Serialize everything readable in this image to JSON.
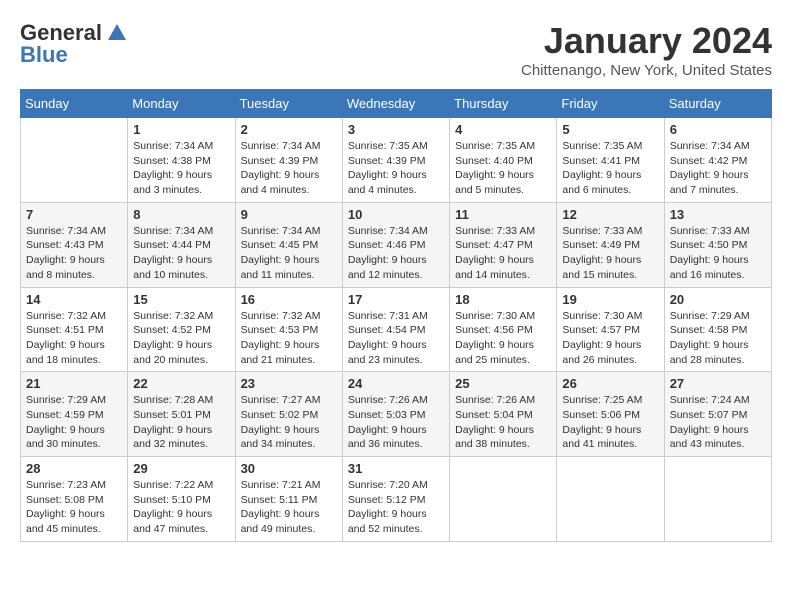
{
  "header": {
    "logo_line1": "General",
    "logo_line2": "Blue",
    "month_title": "January 2024",
    "location": "Chittenango, New York, United States"
  },
  "days_of_week": [
    "Sunday",
    "Monday",
    "Tuesday",
    "Wednesday",
    "Thursday",
    "Friday",
    "Saturday"
  ],
  "weeks": [
    [
      {
        "day": "",
        "sunrise": "",
        "sunset": "",
        "daylight": ""
      },
      {
        "day": "1",
        "sunrise": "Sunrise: 7:34 AM",
        "sunset": "Sunset: 4:38 PM",
        "daylight": "Daylight: 9 hours and 3 minutes."
      },
      {
        "day": "2",
        "sunrise": "Sunrise: 7:34 AM",
        "sunset": "Sunset: 4:39 PM",
        "daylight": "Daylight: 9 hours and 4 minutes."
      },
      {
        "day": "3",
        "sunrise": "Sunrise: 7:35 AM",
        "sunset": "Sunset: 4:39 PM",
        "daylight": "Daylight: 9 hours and 4 minutes."
      },
      {
        "day": "4",
        "sunrise": "Sunrise: 7:35 AM",
        "sunset": "Sunset: 4:40 PM",
        "daylight": "Daylight: 9 hours and 5 minutes."
      },
      {
        "day": "5",
        "sunrise": "Sunrise: 7:35 AM",
        "sunset": "Sunset: 4:41 PM",
        "daylight": "Daylight: 9 hours and 6 minutes."
      },
      {
        "day": "6",
        "sunrise": "Sunrise: 7:34 AM",
        "sunset": "Sunset: 4:42 PM",
        "daylight": "Daylight: 9 hours and 7 minutes."
      }
    ],
    [
      {
        "day": "7",
        "sunrise": "Sunrise: 7:34 AM",
        "sunset": "Sunset: 4:43 PM",
        "daylight": "Daylight: 9 hours and 8 minutes."
      },
      {
        "day": "8",
        "sunrise": "Sunrise: 7:34 AM",
        "sunset": "Sunset: 4:44 PM",
        "daylight": "Daylight: 9 hours and 10 minutes."
      },
      {
        "day": "9",
        "sunrise": "Sunrise: 7:34 AM",
        "sunset": "Sunset: 4:45 PM",
        "daylight": "Daylight: 9 hours and 11 minutes."
      },
      {
        "day": "10",
        "sunrise": "Sunrise: 7:34 AM",
        "sunset": "Sunset: 4:46 PM",
        "daylight": "Daylight: 9 hours and 12 minutes."
      },
      {
        "day": "11",
        "sunrise": "Sunrise: 7:33 AM",
        "sunset": "Sunset: 4:47 PM",
        "daylight": "Daylight: 9 hours and 14 minutes."
      },
      {
        "day": "12",
        "sunrise": "Sunrise: 7:33 AM",
        "sunset": "Sunset: 4:49 PM",
        "daylight": "Daylight: 9 hours and 15 minutes."
      },
      {
        "day": "13",
        "sunrise": "Sunrise: 7:33 AM",
        "sunset": "Sunset: 4:50 PM",
        "daylight": "Daylight: 9 hours and 16 minutes."
      }
    ],
    [
      {
        "day": "14",
        "sunrise": "Sunrise: 7:32 AM",
        "sunset": "Sunset: 4:51 PM",
        "daylight": "Daylight: 9 hours and 18 minutes."
      },
      {
        "day": "15",
        "sunrise": "Sunrise: 7:32 AM",
        "sunset": "Sunset: 4:52 PM",
        "daylight": "Daylight: 9 hours and 20 minutes."
      },
      {
        "day": "16",
        "sunrise": "Sunrise: 7:32 AM",
        "sunset": "Sunset: 4:53 PM",
        "daylight": "Daylight: 9 hours and 21 minutes."
      },
      {
        "day": "17",
        "sunrise": "Sunrise: 7:31 AM",
        "sunset": "Sunset: 4:54 PM",
        "daylight": "Daylight: 9 hours and 23 minutes."
      },
      {
        "day": "18",
        "sunrise": "Sunrise: 7:30 AM",
        "sunset": "Sunset: 4:56 PM",
        "daylight": "Daylight: 9 hours and 25 minutes."
      },
      {
        "day": "19",
        "sunrise": "Sunrise: 7:30 AM",
        "sunset": "Sunset: 4:57 PM",
        "daylight": "Daylight: 9 hours and 26 minutes."
      },
      {
        "day": "20",
        "sunrise": "Sunrise: 7:29 AM",
        "sunset": "Sunset: 4:58 PM",
        "daylight": "Daylight: 9 hours and 28 minutes."
      }
    ],
    [
      {
        "day": "21",
        "sunrise": "Sunrise: 7:29 AM",
        "sunset": "Sunset: 4:59 PM",
        "daylight": "Daylight: 9 hours and 30 minutes."
      },
      {
        "day": "22",
        "sunrise": "Sunrise: 7:28 AM",
        "sunset": "Sunset: 5:01 PM",
        "daylight": "Daylight: 9 hours and 32 minutes."
      },
      {
        "day": "23",
        "sunrise": "Sunrise: 7:27 AM",
        "sunset": "Sunset: 5:02 PM",
        "daylight": "Daylight: 9 hours and 34 minutes."
      },
      {
        "day": "24",
        "sunrise": "Sunrise: 7:26 AM",
        "sunset": "Sunset: 5:03 PM",
        "daylight": "Daylight: 9 hours and 36 minutes."
      },
      {
        "day": "25",
        "sunrise": "Sunrise: 7:26 AM",
        "sunset": "Sunset: 5:04 PM",
        "daylight": "Daylight: 9 hours and 38 minutes."
      },
      {
        "day": "26",
        "sunrise": "Sunrise: 7:25 AM",
        "sunset": "Sunset: 5:06 PM",
        "daylight": "Daylight: 9 hours and 41 minutes."
      },
      {
        "day": "27",
        "sunrise": "Sunrise: 7:24 AM",
        "sunset": "Sunset: 5:07 PM",
        "daylight": "Daylight: 9 hours and 43 minutes."
      }
    ],
    [
      {
        "day": "28",
        "sunrise": "Sunrise: 7:23 AM",
        "sunset": "Sunset: 5:08 PM",
        "daylight": "Daylight: 9 hours and 45 minutes."
      },
      {
        "day": "29",
        "sunrise": "Sunrise: 7:22 AM",
        "sunset": "Sunset: 5:10 PM",
        "daylight": "Daylight: 9 hours and 47 minutes."
      },
      {
        "day": "30",
        "sunrise": "Sunrise: 7:21 AM",
        "sunset": "Sunset: 5:11 PM",
        "daylight": "Daylight: 9 hours and 49 minutes."
      },
      {
        "day": "31",
        "sunrise": "Sunrise: 7:20 AM",
        "sunset": "Sunset: 5:12 PM",
        "daylight": "Daylight: 9 hours and 52 minutes."
      },
      {
        "day": "",
        "sunrise": "",
        "sunset": "",
        "daylight": ""
      },
      {
        "day": "",
        "sunrise": "",
        "sunset": "",
        "daylight": ""
      },
      {
        "day": "",
        "sunrise": "",
        "sunset": "",
        "daylight": ""
      }
    ]
  ]
}
